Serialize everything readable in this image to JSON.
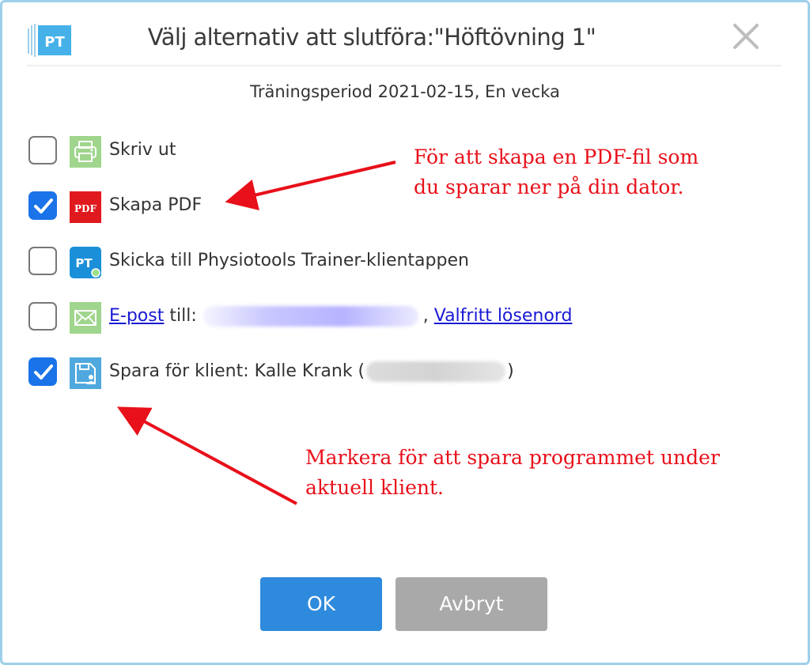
{
  "dialog": {
    "logo_text": "PT",
    "title": "Välj alternativ att slutföra:\"Höftövning 1\"",
    "subtitle": "Träningsperiod 2021-02-15, En vecka"
  },
  "options": [
    {
      "label": "Skriv ut",
      "checked": false,
      "icon": "printer-icon"
    },
    {
      "label": "Skapa PDF",
      "checked": true,
      "icon": "pdf-icon",
      "icon_text": "PDF"
    },
    {
      "label": "Skicka till Physiotools Trainer-klientappen",
      "checked": false,
      "icon": "pt-app-icon",
      "icon_text": "PT"
    },
    {
      "label_link": "E-post",
      "label_mid": " till:",
      "label_sep": ",",
      "label_link2": "Valfritt lösenord",
      "checked": false,
      "icon": "envelope-icon"
    },
    {
      "label": "Spara för klient: Kalle Krank (",
      "label_end": ")",
      "checked": true,
      "icon": "save-client-icon"
    }
  ],
  "annotations": {
    "pdf_note_line1": "För att skapa en PDF-fil som",
    "pdf_note_line2": "du sparar ner på din dator.",
    "save_note_line1": "Markera för att spara programmet under",
    "save_note_line2": "aktuell klient."
  },
  "buttons": {
    "ok": "OK",
    "cancel": "Avbryt"
  },
  "colors": {
    "accent": "#2e8adc",
    "checkbox_checked": "#1a73e8",
    "annotation": "#e8101a",
    "link": "#1919d4",
    "cancel_button": "#a9a9a9"
  }
}
